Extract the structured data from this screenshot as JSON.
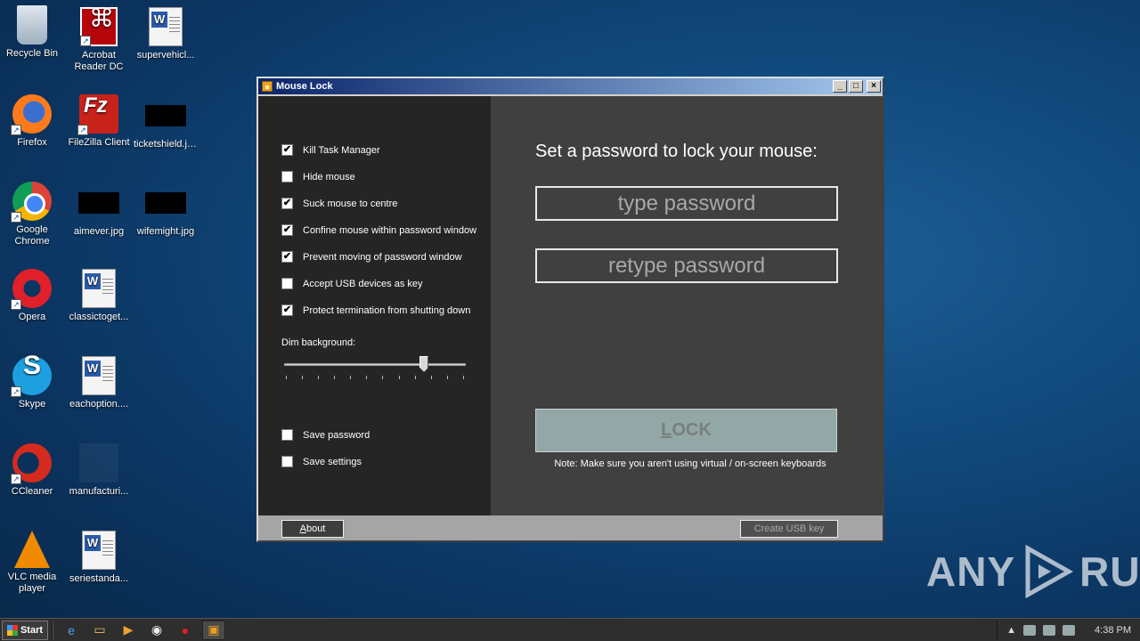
{
  "desktop": {
    "icons": [
      {
        "label": "Recycle Bin"
      },
      {
        "label": "Acrobat Reader DC"
      },
      {
        "label": "supervehicl..."
      },
      {
        "label": "Firefox"
      },
      {
        "label": "FileZilla Client"
      },
      {
        "label": "ticketshield.jpg"
      },
      {
        "label": "Google Chrome"
      },
      {
        "label": "aimever.jpg"
      },
      {
        "label": "wifemight.jpg"
      },
      {
        "label": "Opera"
      },
      {
        "label": "classictoget..."
      },
      {
        "label": "Skype"
      },
      {
        "label": "eachoption...."
      },
      {
        "label": "CCleaner"
      },
      {
        "label": "manufacturi..."
      },
      {
        "label": "VLC media player"
      },
      {
        "label": "seriestanda..."
      }
    ]
  },
  "window": {
    "title": "Mouse Lock",
    "controls": {
      "minimize": "_",
      "maximize": "□",
      "close": "×"
    }
  },
  "options": [
    {
      "label": "Kill Task Manager",
      "checked": true,
      "mark": "✔"
    },
    {
      "label": "Hide mouse",
      "checked": false,
      "mark": ""
    },
    {
      "label": "Suck mouse to centre",
      "checked": true,
      "mark": "✔"
    },
    {
      "label": "Confine mouse within password window",
      "checked": true,
      "mark": "✔"
    },
    {
      "label": "Prevent moving of password window",
      "checked": true,
      "mark": "✔"
    },
    {
      "label": "Accept USB devices as key",
      "checked": false,
      "mark": ""
    },
    {
      "label": "Protect termination from shutting down",
      "checked": true,
      "mark": "✔"
    }
  ],
  "dim": {
    "label": "Dim background:",
    "value": 0.77,
    "ticks": 12
  },
  "save_options": [
    {
      "label": "Save password",
      "checked": false,
      "mark": ""
    },
    {
      "label": "Save settings",
      "checked": false,
      "mark": ""
    }
  ],
  "lock_panel": {
    "heading": "Set a password to lock your mouse:",
    "password_placeholder": "type password",
    "retype_placeholder": "retype password",
    "lock_label_u": "L",
    "lock_label_rest": "OCK",
    "note": "Note: Make sure you aren't using virtual / on-screen keyboards"
  },
  "buttons": {
    "about_u": "A",
    "about_rest": "bout",
    "create_usb_key": "Create USB key"
  },
  "taskbar": {
    "start": "Start",
    "clock": "4:38 PM",
    "tray_arrow": "▲"
  },
  "watermark": {
    "left": "ANY",
    "right": "RUN"
  }
}
